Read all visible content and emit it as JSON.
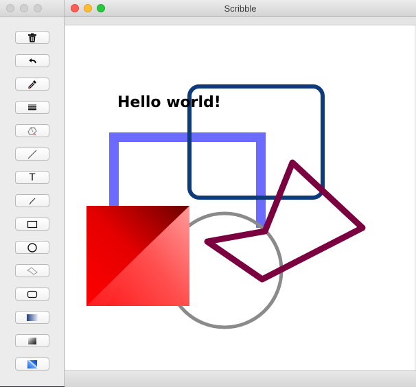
{
  "palette": {
    "tools": [
      {
        "name": "trash-tool-button",
        "icon": "trash-icon"
      },
      {
        "name": "undo-tool-button",
        "icon": "undo-icon"
      },
      {
        "name": "color-picker-tool-button",
        "icon": "eyedropper-icon"
      },
      {
        "name": "line-width-tool-button",
        "icon": "line-width-icon"
      },
      {
        "name": "eraser-tool-button",
        "icon": "eraser-icon"
      },
      {
        "name": "line-tool-button",
        "icon": "line-icon"
      },
      {
        "name": "text-tool-button",
        "icon": "text-icon",
        "label": "T"
      },
      {
        "name": "brush-tool-button",
        "icon": "brush-icon"
      },
      {
        "name": "rectangle-tool-button",
        "icon": "rectangle-icon"
      },
      {
        "name": "ellipse-tool-button",
        "icon": "ellipse-icon"
      },
      {
        "name": "polygon-tool-button",
        "icon": "polygon-icon"
      },
      {
        "name": "rounded-rect-tool-button",
        "icon": "rounded-rectangle-icon"
      },
      {
        "name": "gradient-tool-button",
        "icon": "linear-gradient-icon"
      },
      {
        "name": "shadow-gradient-tool-button",
        "icon": "diagonal-gradient-icon"
      },
      {
        "name": "fill-pattern-tool-button",
        "icon": "fill-pattern-icon"
      }
    ]
  },
  "window": {
    "title": "Scribble"
  },
  "canvas": {
    "text_label": "Hello world!",
    "colors": {
      "blue_frame": "#6b6bff",
      "navy_rounded_rect": "#0d3a7a",
      "gray_circle": "#8a8a8a",
      "maroon_polygon": "#7a0040",
      "red_gradient_light": "#ff6b6b",
      "red_gradient_dark": "#6b0000"
    }
  }
}
